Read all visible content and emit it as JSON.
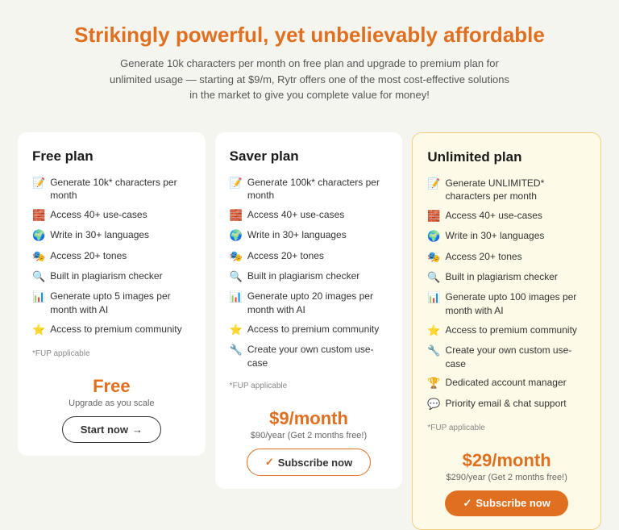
{
  "header": {
    "title_regular": "Strikingly powerful, yet unbelievably",
    "title_accent": "affordable",
    "subtitle": "Generate 10k characters per month on free plan and upgrade to premium plan for unlimited usage — starting at $9/m, Rytr offers one of the most cost-effective solutions in the market to give you complete value for money!"
  },
  "plans": [
    {
      "id": "free",
      "title": "Free plan",
      "features": [
        {
          "emoji": "📝",
          "text": "Generate 10k* characters per month"
        },
        {
          "emoji": "🧱",
          "text": "Access 40+ use-cases"
        },
        {
          "emoji": "🌍",
          "text": "Write in 30+ languages"
        },
        {
          "emoji": "🎭",
          "text": "Access 20+ tones"
        },
        {
          "emoji": "🔍",
          "text": "Built in plagiarism checker"
        },
        {
          "emoji": "📊",
          "text": "Generate upto 5 images per month with AI"
        },
        {
          "emoji": "⭐",
          "text": "Access to premium community"
        }
      ],
      "fup": "*FUP applicable",
      "price": "Free",
      "price_sub": "Upgrade as you scale",
      "btn_label": "Start now",
      "btn_type": "outline",
      "btn_icon": "arrow"
    },
    {
      "id": "saver",
      "title": "Saver plan",
      "features": [
        {
          "emoji": "📝",
          "text": "Generate 100k* characters per month"
        },
        {
          "emoji": "🧱",
          "text": "Access 40+ use-cases"
        },
        {
          "emoji": "🌍",
          "text": "Write in 30+ languages"
        },
        {
          "emoji": "🎭",
          "text": "Access 20+ tones"
        },
        {
          "emoji": "🔍",
          "text": "Built in plagiarism checker"
        },
        {
          "emoji": "📊",
          "text": "Generate upto 20 images per month with AI"
        },
        {
          "emoji": "⭐",
          "text": "Access to premium community"
        },
        {
          "emoji": "🔧",
          "text": "Create your own custom use-case"
        }
      ],
      "fup": "*FUP applicable",
      "price": "$9/month",
      "price_sub": "$90/year (Get 2 months free!)",
      "btn_label": "Subscribe now",
      "btn_type": "outline-orange",
      "btn_icon": "check"
    },
    {
      "id": "unlimited",
      "title": "Unlimited plan",
      "features": [
        {
          "emoji": "📝",
          "text": "Generate UNLIMITED* characters per month"
        },
        {
          "emoji": "🧱",
          "text": "Access 40+ use-cases"
        },
        {
          "emoji": "🌍",
          "text": "Write in 30+ languages"
        },
        {
          "emoji": "🎭",
          "text": "Access 20+ tones"
        },
        {
          "emoji": "🔍",
          "text": "Built in plagiarism checker"
        },
        {
          "emoji": "📊",
          "text": "Generate upto 100 images per month with AI"
        },
        {
          "emoji": "⭐",
          "text": "Access to premium community"
        },
        {
          "emoji": "🔧",
          "text": "Create your own custom use-case"
        },
        {
          "emoji": "🏆",
          "text": "Dedicated account manager"
        },
        {
          "emoji": "💬",
          "text": "Priority email & chat support"
        }
      ],
      "fup": "*FUP applicable",
      "price": "$29/month",
      "price_sub": "$290/year (Get 2 months free!)",
      "btn_label": "Subscribe now",
      "btn_type": "filled",
      "btn_icon": "check"
    }
  ]
}
